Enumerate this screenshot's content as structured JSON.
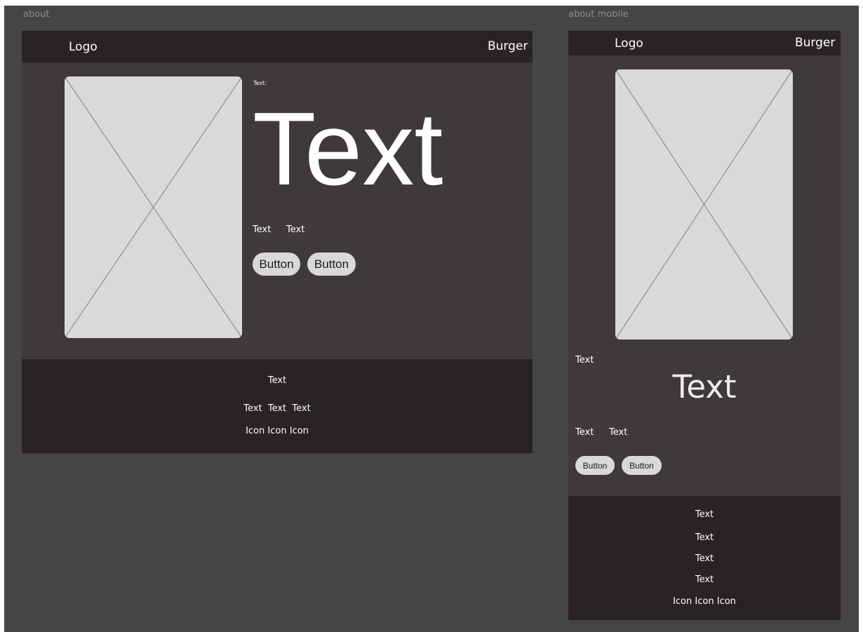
{
  "colors": {
    "canvas": "#454545",
    "frame": "#403939",
    "header_footer": "#2a2323",
    "placeholder": "#d9d9d9",
    "label": "#8c8c8c",
    "text": "#ffffff"
  },
  "desktop": {
    "frame_label": "about",
    "header": {
      "logo": "Logo",
      "burger": "Burger"
    },
    "hero": {
      "small_label": "Text:",
      "headline": "Text",
      "meta": [
        "Text",
        "Text"
      ],
      "buttons": [
        "Button",
        "Button"
      ]
    },
    "footer": {
      "title": "Text",
      "links": [
        "Text",
        "Text",
        "Text"
      ],
      "icons": [
        "Icon",
        "Icon",
        "Icon"
      ]
    }
  },
  "mobile": {
    "frame_label": "about mobile",
    "header": {
      "logo": "Logo",
      "burger": "Burger"
    },
    "hero": {
      "small_label": "Text",
      "headline": "Text",
      "meta": [
        "Text",
        "Text"
      ],
      "buttons": [
        "Button",
        "Button"
      ]
    },
    "footer": {
      "rows": [
        "Text",
        "Text",
        "Text",
        "Text"
      ],
      "icons": [
        "Icon",
        "Icon",
        "Icon"
      ]
    }
  }
}
